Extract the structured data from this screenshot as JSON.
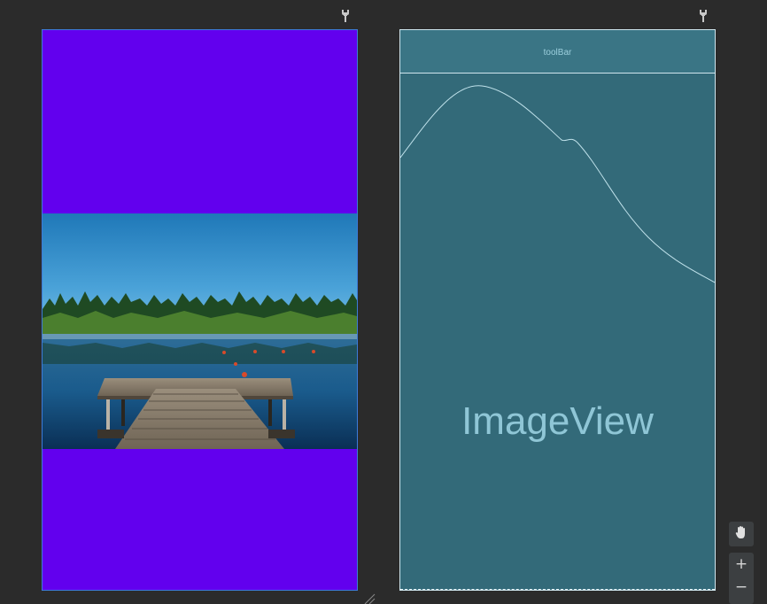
{
  "blueprint": {
    "toolbar_label": "toolBar",
    "image_label": "ImageView"
  },
  "icons": {
    "pin_left": "pin-icon",
    "pin_right": "pin-icon",
    "pan": "hand-icon",
    "zoom_in": "plus-icon",
    "zoom_out": "minus-icon",
    "resize": "resize-handle-icon"
  },
  "zoom": {
    "in_label": "+",
    "out_label": "−"
  },
  "colors": {
    "canvas_bg": "#2b2b2b",
    "design_bg": "#6200ee",
    "design_border": "#3d7bd9",
    "blueprint_bg": "#336a79",
    "blueprint_line": "#cfe6ee",
    "blueprint_text": "#8fc6d6"
  }
}
